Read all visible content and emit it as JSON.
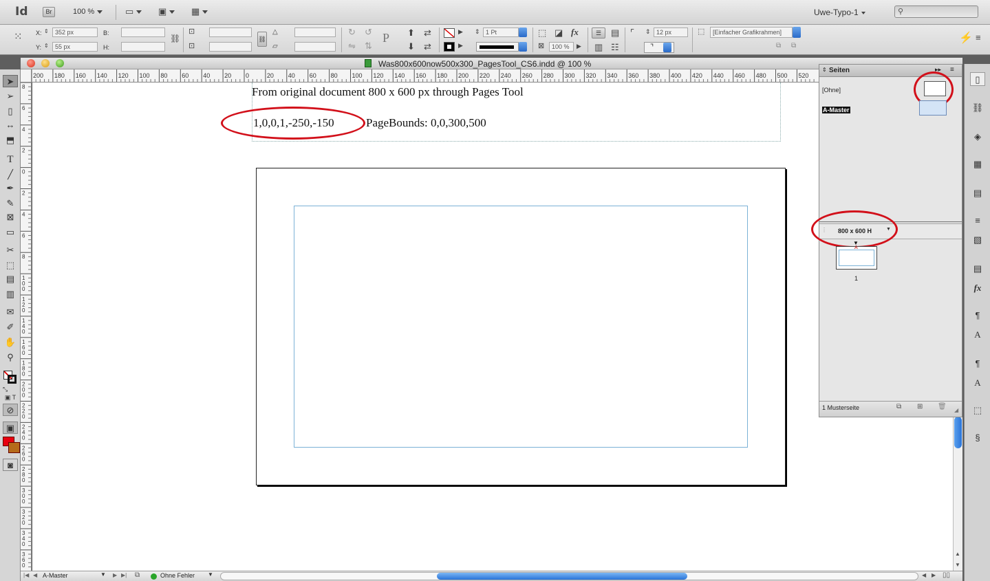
{
  "app": {
    "logo": "Id",
    "bridge": "Br",
    "zoom": "100 %",
    "workspace": "Uwe-Typo-1"
  },
  "control": {
    "x_label": "X:",
    "x_value": "352 px",
    "y_label": "Y:",
    "y_value": "55 px",
    "w_label": "B:",
    "h_label": "H:",
    "stroke_weight": "1 Pt",
    "scale": "100 %",
    "corner": "12 px",
    "object_style": "[Einfacher Grafikrahmen]"
  },
  "document": {
    "title": "Was800x600now500x300_PagesTool_CS6.indd @ 100 %",
    "line1": "From original document 800 x 600 px through Pages Tool",
    "line2a": "1,0,0,1,-250,-150",
    "line2b": "PageBounds: 0,0,300,500"
  },
  "ruler": {
    "h_ticks": [
      "200",
      "180",
      "160",
      "140",
      "120",
      "100",
      "80",
      "60",
      "40",
      "20",
      "0",
      "20",
      "40",
      "60",
      "80",
      "100",
      "120",
      "140",
      "160",
      "180",
      "200",
      "220",
      "240",
      "260",
      "280",
      "300",
      "320",
      "340",
      "360",
      "380",
      "400",
      "420",
      "440",
      "460",
      "480",
      "500",
      "520"
    ],
    "v_ticks": [
      "8",
      "6",
      "4",
      "2",
      "0",
      "2",
      "4",
      "6",
      "8",
      "1 0 0",
      "1 2 0",
      "1 4 0",
      "1 6 0",
      "1 8 0",
      "2 0 0",
      "2 2 0",
      "2 4 0",
      "2 6 0",
      "2 8 0",
      "3 0 0",
      "3 2 0",
      "3 4 0",
      "3 6 0"
    ]
  },
  "pages_panel": {
    "title": "Seiten",
    "none_label": "[Ohne]",
    "master_label": "A-Master",
    "size_dropdown": "800 x 600 H",
    "page_number": "1",
    "page_prefix": "A",
    "footer": "1 Musterseite"
  },
  "status": {
    "page": "A-Master",
    "preflight": "Ohne Fehler"
  },
  "colors": {
    "annotation_red": "#d2101a",
    "fill_swatch": "#e8000f",
    "stroke_swatch": "#b56a1a",
    "margin_guide": "#7ab1d6",
    "selected_master_bg": "#111111"
  }
}
